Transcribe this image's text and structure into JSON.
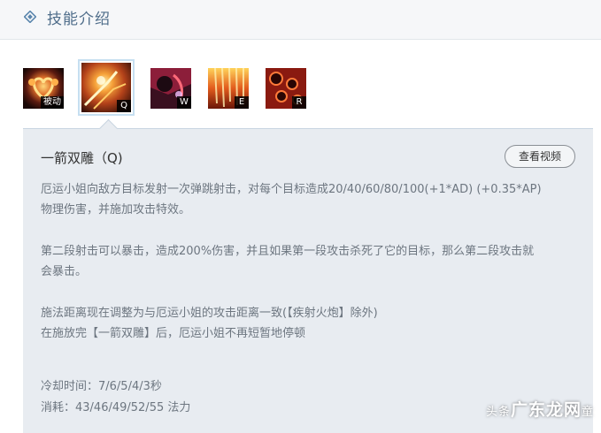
{
  "header": {
    "title": "技能介绍",
    "icon": "diamond-icon"
  },
  "skills": [
    {
      "key": "被动",
      "icon": "passive-skill-icon"
    },
    {
      "key": "Q",
      "icon": "q-skill-icon",
      "active": true
    },
    {
      "key": "W",
      "icon": "w-skill-icon"
    },
    {
      "key": "E",
      "icon": "e-skill-icon"
    },
    {
      "key": "R",
      "icon": "r-skill-icon"
    }
  ],
  "detail": {
    "title": "一箭双雕（Q)",
    "video_button": "查看视频",
    "paragraphs": [
      "厄运小姐向敌方目标发射一次弹跳射击，对每个目标造成20/40/60/80/100(+1*AD) (+0.35*AP)",
      "物理伤害，并施加攻击特效。",
      "第二段射击可以暴击，造成200%伤害，并且如果第一段攻击杀死了它的目标，那么第二段攻击就",
      "会暴击。",
      "施法距离现在调整为与厄运小姐的攻击距离一致(【疾射火炮】除外)",
      "在施放完【一箭双雕】后，厄运小姐不再短暂地停顿"
    ],
    "cooldown": "冷却时间：7/6/5/4/3秒",
    "cost": "消耗：43/46/49/52/55 法力"
  },
  "watermark": {
    "prefix": "头条",
    "brand": "广东龙网",
    "suffix": "童"
  },
  "colors": {
    "header_text": "#4f6d8a",
    "panel_bg": "#e8ecf1",
    "desc_text": "#6d7680"
  }
}
